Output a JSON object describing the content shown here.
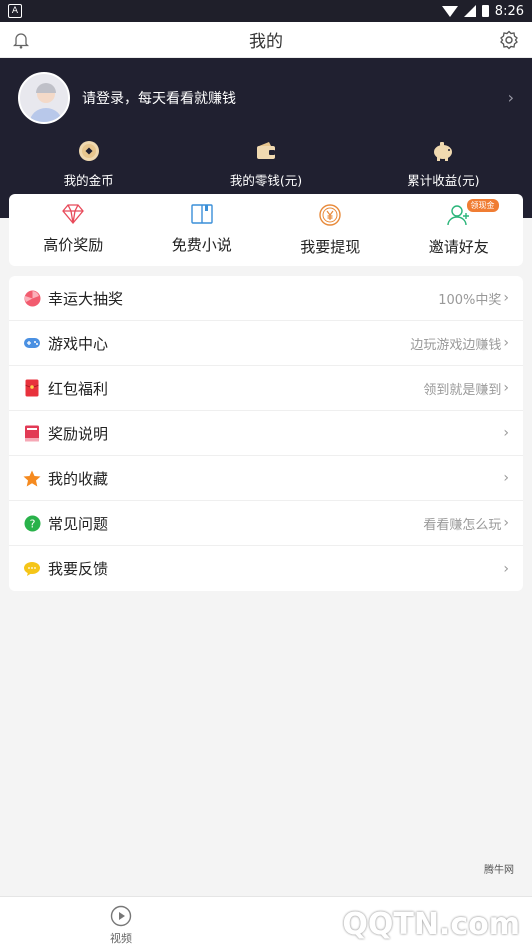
{
  "status_bar": {
    "time": "8:26",
    "app_icon": "A"
  },
  "topbar": {
    "title": "我的"
  },
  "login": {
    "text": "请登录，每天看看就赚钱"
  },
  "stats": [
    {
      "label": "我的金币",
      "icon": "coin-icon"
    },
    {
      "label": "我的零钱(元)",
      "icon": "wallet-icon"
    },
    {
      "label": "累计收益(元)",
      "icon": "piggy-bank-icon"
    }
  ],
  "quick_actions": [
    {
      "label": "高价奖励",
      "icon": "diamond-icon"
    },
    {
      "label": "免费小说",
      "icon": "book-icon"
    },
    {
      "label": "我要提现",
      "icon": "yen-icon"
    },
    {
      "label": "邀请好友",
      "icon": "user-add-icon",
      "badge": "领现金"
    }
  ],
  "menu": [
    {
      "label": "幸运大抽奖",
      "hint": "100%中奖",
      "icon": "lucky-draw-icon",
      "color": "#f25c6f"
    },
    {
      "label": "游戏中心",
      "hint": "边玩游戏边赚钱",
      "icon": "gamepad-icon",
      "color": "#4a90e2"
    },
    {
      "label": "红包福利",
      "hint": "领到就是赚到",
      "icon": "red-envelope-icon",
      "color": "#e8323c"
    },
    {
      "label": "奖励说明",
      "hint": "",
      "icon": "notebook-icon",
      "color": "#e23a55"
    },
    {
      "label": "我的收藏",
      "hint": "",
      "icon": "star-icon",
      "color": "#f58a1f"
    },
    {
      "label": "常见问题",
      "hint": "看看赚怎么玩",
      "icon": "question-icon",
      "color": "#29b24a"
    },
    {
      "label": "我要反馈",
      "hint": "",
      "icon": "feedback-icon",
      "color": "#f5c518"
    }
  ],
  "bottom_nav": {
    "video_label": "视频"
  },
  "watermark": {
    "logo": "QQTN.com",
    "site": "腾牛网"
  }
}
